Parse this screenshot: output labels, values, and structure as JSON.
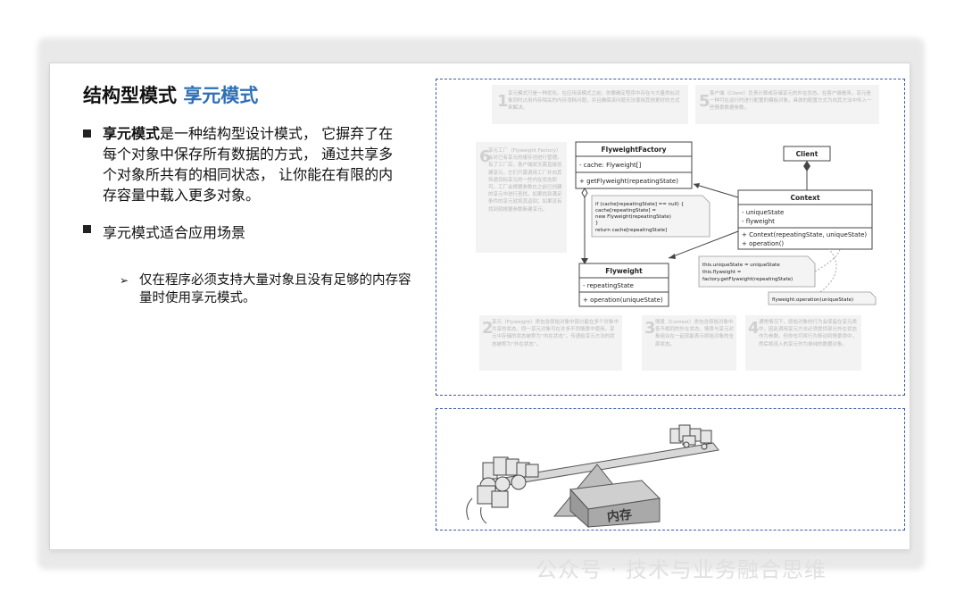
{
  "slide": {
    "title_prefix": "结构型模式",
    "title_accent": "享元模式",
    "bullet1_bold": "享元模式",
    "bullet1_rest": "是一种结构型设计模式， 它摒弃了在每个对象中保存所有数据的方式， 通过共享多个对象所共有的相同状态， 让你能在有限的内存容量中载入更多对象。",
    "bullet2": "享元模式适合应用场景",
    "sub_bullet": "仅在程序必须支持大量对象且没有足够的内存容量时使用享元模式。",
    "arrow_glyph": "➢"
  },
  "diagram": {
    "note1_num": "1",
    "note1": "享元模式只是一种优化。在应用该模式之前，你要确定程序中存在与大量类似对象同时占用内存相关的内存消耗问题，并且确保该问题无法使用其他更好的方式来解决。",
    "note5_num": "5",
    "note5": "客户端（Client）负责计算或存储享元的外在状态。在客户端看来，享元是一种可在运行时进行配置的模板对象，具体的配置方式为向其方法中传入一些情景数据参数。",
    "note6_num": "6",
    "note6": "享元工厂（Flyweight Factory）会对已有享元的缓存池进行管理。有了工厂后，客户端就无需直接创建享元，它们只需调用工厂并向其传递目标享元的一些内在状态即可。工厂会根据参数在之前已创建的享元中进行查找，如果找到满足条件的享元就将其返回；如果没有找到就根据参数新建享元。",
    "note2_num": "2",
    "note2": "享元（Flyweight）类包含原始对象中部分能在多个对象中共享的状态。同一享元对象可在许多不同情景中使用。享元中存储的状态被称为“内在状态”。传递给享元方法的状态被称为“外在状态”。",
    "note3_num": "3",
    "note3": "情景（Context）类包含原始对象中各不相同的外在状态。情景与享元对象组合在一起就能表示原始对象的全部状态。",
    "note4_num": "4",
    "note4": "通常情况下，原始对象的行为会保留在享元类中。因此调用享元方法必须提供部分外在状态作为参数。但你也可将行为移动到情景类中，然后将连入的享元作为单纯的数据对象。",
    "factory_title": "FlyweightFactory",
    "factory_field": "- cache: Flyweight[]",
    "factory_method": "+ getFlyweight(repeatingState)",
    "code_lines": [
      "if (cache[repeatingState] == null) {",
      "  cache[repeatingState] =",
      "      new Flyweight(repeatingState)",
      "}",
      "return cache[repeatingState]"
    ],
    "client_title": "Client",
    "context_title": "Context",
    "context_fields": [
      "- uniqueState",
      "- flyweight"
    ],
    "context_methods": [
      "+ Context(repeatingState, uniqueState)",
      "+ operation()"
    ],
    "flyweight_title": "Flyweight",
    "flyweight_field": "- repeatingState",
    "flyweight_method": "+ operation(uniqueState)",
    "ctor_note": [
      "this.uniqueState = uniqueState",
      "this.flyweight =",
      "factory.getFlyweight(repeatingState)"
    ],
    "op_note": "flyweight.operation(uniqueState)"
  },
  "illustration": {
    "memory_label": "内存"
  },
  "watermark": "公众号 · 技术与业务融合思维"
}
